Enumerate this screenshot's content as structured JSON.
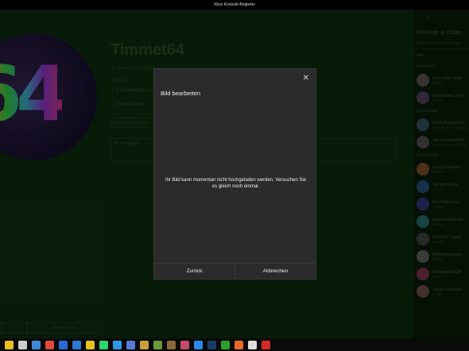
{
  "window": {
    "title": "Xbox Konsole-Begleiter"
  },
  "profile": {
    "gamertag": "Timmet64",
    "avatar_text": "64",
    "change_gamertag": "Gamertag ändern",
    "subtitle": "Ihr Konto",
    "settings": "Einstellungen ändern",
    "color": "Farbe ändern",
    "location_placeholder": "Ihren Ort hinzufügen",
    "bio_placeholder": "Bio hinzufügen"
  },
  "bottom": {
    "save": "",
    "cancel": "Abbrechen"
  },
  "sidebar": {
    "title": "Freunde & Clubs",
    "search_placeholder": "Personen oder Clubs suc...",
    "filter": "Alle",
    "online_header": "Online (2)",
    "suggest_header": "Vorschläge",
    "offline_header": "Offline (14)",
    "friends": [
      {
        "name": "Sass Meh (ich)",
        "status": "Online",
        "color": "#6b5a5a"
      },
      {
        "name": "LRattmann Zum",
        "status": "Online",
        "color": "#5a4b6b"
      },
      {
        "name": "DoomDude2100",
        "status": "Freund von Freunden",
        "color": "#3a5a6b"
      },
      {
        "name": "JBeastmode905",
        "status": "Freund von Freunden",
        "color": "#5a5a5a"
      },
      {
        "name": "Lonely Islands",
        "status": "Online",
        "color": "#8a5a2a"
      },
      {
        "name": "No Mans Sky",
        "status": "Online",
        "color": "#2a5a8a"
      },
      {
        "name": "Dachshkieser",
        "status": "Online",
        "color": "#3a3a8a"
      },
      {
        "name": "DiamondGleeko",
        "status": "Online",
        "color": "#2a7a7a"
      },
      {
        "name": "Faulk01 Ycarni",
        "status": "Online",
        "color": "#4a4a4a"
      },
      {
        "name": "OfflPolemgame",
        "status": "Offline",
        "color": "#6a6a6a"
      },
      {
        "name": "RedheadCol24",
        "status": "Offline",
        "color": "#8a3a5a"
      },
      {
        "name": "Jessie Scheibe",
        "status": "Online",
        "color": "#7a5a5a"
      }
    ]
  },
  "dialog": {
    "title": "Bild bearbeiten",
    "message": "Ihr Bild kann momentan nicht hochgeladen werden. Versuchen Sie es gleich noch einmal.",
    "back": "Zurück",
    "cancel": "Abbrechen"
  },
  "taskbar": {
    "icons": [
      "norton-icon",
      "sword-icon",
      "bird-icon",
      "chrome-icon",
      "calendar-icon",
      "mail-icon",
      "store-icon",
      "whatsapp-icon",
      "telegram-icon",
      "ie-icon",
      "explorer-icon",
      "minecraft-icon",
      "minecraft2-icon",
      "app-icon",
      "edge-icon",
      "steam-icon",
      "xbox-icon",
      "firefox-icon",
      "film-icon",
      "red-icon"
    ],
    "colors": [
      "#e8c020",
      "#cccccc",
      "#3a8ad6",
      "#e04a3a",
      "#2a6ad6",
      "#2a7ad6",
      "#e8c020",
      "#2ad66a",
      "#2a9ae8",
      "#5a7ad6",
      "#c8a040",
      "#6a9a3a",
      "#8a6a3a",
      "#c04a6a",
      "#2a8ae8",
      "#1a3a6a",
      "#2aa02a",
      "#e86a2a",
      "#dddddd",
      "#d62a2a"
    ]
  }
}
